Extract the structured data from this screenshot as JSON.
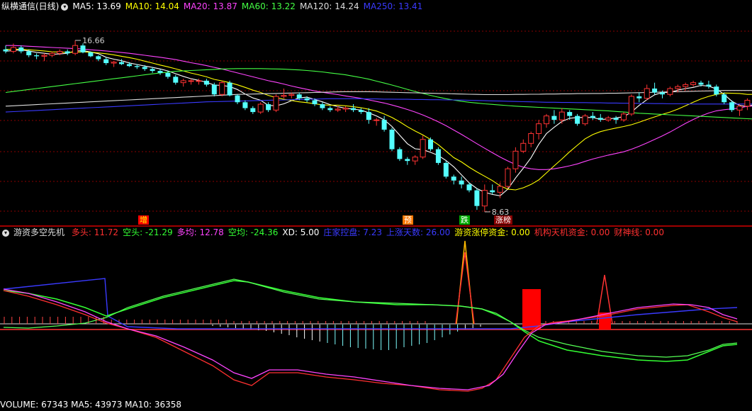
{
  "main_legend": {
    "title": "纵横通信(日线)",
    "items": [
      {
        "label": "MA5: 13.69",
        "color": "#ffffff"
      },
      {
        "label": "MA10: 14.04",
        "color": "#ffff00"
      },
      {
        "label": "MA20: 13.87",
        "color": "#ff44ff"
      },
      {
        "label": "MA60: 13.22",
        "color": "#44ff44"
      },
      {
        "label": "MA120: 14.24",
        "color": "#dddddd"
      },
      {
        "label": "MA250: 13.41",
        "color": "#3a3aff"
      }
    ]
  },
  "price_labels": {
    "high": "16.66",
    "low": "8.63"
  },
  "signals": [
    {
      "text": "增",
      "bg": "#ff0000",
      "color": "#ffff00"
    },
    {
      "text": "预",
      "bg": "#ff7700",
      "color": "#ffffff"
    },
    {
      "text": "跌",
      "bg": "#00aa00",
      "color": "#ffffff"
    },
    {
      "text": "涨榜",
      "bg": "#880000",
      "color": "#ffffff"
    }
  ],
  "sub_legend": {
    "title": "游资多空先机",
    "items": [
      {
        "label": "多头: 11.72",
        "color": "#ff3030"
      },
      {
        "label": "空头: -21.29",
        "color": "#33ff33"
      },
      {
        "label": "多均: 12.78",
        "color": "#ff44ff"
      },
      {
        "label": "空均: -24.36",
        "color": "#33ff33"
      },
      {
        "label": "XD: 5.00",
        "color": "#ffffff"
      },
      {
        "label": "庄家控盘: 7.23",
        "color": "#3a3aff"
      },
      {
        "label": "上涨天数: 26.00",
        "color": "#3a3aff"
      },
      {
        "label": "游资涨停资金: 0.00",
        "color": "#ffff00"
      },
      {
        "label": "机构天机资金: 0.00",
        "color": "#ff3030"
      },
      {
        "label": "财神线: 0.00",
        "color": "#ff3030"
      }
    ]
  },
  "volume_legend": "VOLUME: 67343  MA5: 43973  MA10: 36358",
  "colors": {
    "up": "#ff3333",
    "down": "#54ffff",
    "grid": "#8b0000",
    "divider": "#a00000"
  },
  "chart_data": {
    "type": "candlestick",
    "ylim": [
      7.5,
      18.0
    ],
    "candles": [
      [
        16.2,
        16.4,
        16.0,
        16.1
      ],
      [
        16.1,
        16.5,
        16.0,
        16.3
      ],
      [
        16.3,
        16.4,
        16.0,
        16.1
      ],
      [
        16.1,
        16.2,
        15.8,
        15.9
      ],
      [
        15.9,
        16.0,
        15.7,
        15.85
      ],
      [
        15.85,
        16.0,
        15.6,
        15.9
      ],
      [
        15.9,
        16.1,
        15.8,
        16.0
      ],
      [
        16.0,
        16.2,
        15.9,
        16.1
      ],
      [
        16.1,
        16.2,
        15.9,
        16.0
      ],
      [
        16.0,
        16.66,
        15.9,
        16.4
      ],
      [
        16.4,
        16.5,
        16.0,
        16.05
      ],
      [
        16.05,
        16.1,
        15.8,
        15.85
      ],
      [
        15.85,
        15.9,
        15.6,
        15.7
      ],
      [
        15.7,
        15.8,
        15.4,
        15.5
      ],
      [
        15.5,
        15.6,
        15.3,
        15.55
      ],
      [
        15.55,
        15.7,
        15.4,
        15.45
      ],
      [
        15.45,
        15.55,
        15.3,
        15.35
      ],
      [
        15.35,
        15.45,
        15.2,
        15.3
      ],
      [
        15.3,
        15.4,
        15.1,
        15.2
      ],
      [
        15.2,
        15.3,
        15.0,
        15.1
      ],
      [
        15.1,
        15.2,
        14.9,
        15.0
      ],
      [
        15.0,
        15.1,
        14.7,
        14.8
      ],
      [
        14.8,
        14.9,
        14.4,
        14.5
      ],
      [
        14.5,
        14.7,
        14.3,
        14.6
      ],
      [
        14.6,
        14.7,
        14.4,
        14.6
      ],
      [
        14.6,
        14.7,
        14.4,
        14.6
      ],
      [
        14.6,
        14.7,
        14.3,
        14.4
      ],
      [
        14.4,
        14.5,
        13.8,
        13.9
      ],
      [
        13.9,
        14.6,
        13.8,
        14.5
      ],
      [
        14.5,
        14.6,
        13.8,
        13.85
      ],
      [
        13.85,
        13.9,
        13.4,
        13.5
      ],
      [
        13.5,
        13.6,
        13.1,
        13.2
      ],
      [
        13.2,
        13.3,
        12.9,
        13.0
      ],
      [
        13.0,
        13.5,
        12.9,
        13.4
      ],
      [
        13.4,
        13.5,
        13.0,
        13.1
      ],
      [
        13.1,
        13.9,
        13.0,
        13.8
      ],
      [
        13.8,
        14.2,
        13.7,
        13.85
      ],
      [
        13.85,
        14.0,
        13.7,
        13.9
      ],
      [
        13.9,
        14.0,
        13.6,
        13.7
      ],
      [
        13.7,
        13.8,
        13.5,
        13.6
      ],
      [
        13.6,
        13.7,
        13.3,
        13.4
      ],
      [
        13.4,
        13.5,
        13.1,
        13.2
      ],
      [
        13.2,
        13.3,
        13.0,
        13.1
      ],
      [
        13.1,
        13.3,
        13.0,
        13.15
      ],
      [
        13.15,
        13.3,
        13.0,
        13.2
      ],
      [
        13.2,
        13.4,
        13.0,
        13.1
      ],
      [
        13.1,
        13.2,
        12.9,
        13.0
      ],
      [
        13.0,
        13.2,
        12.4,
        12.6
      ],
      [
        12.6,
        12.7,
        12.3,
        12.6
      ],
      [
        12.6,
        12.8,
        12.0,
        12.1
      ],
      [
        12.1,
        12.2,
        11.0,
        11.1
      ],
      [
        11.1,
        11.2,
        10.5,
        10.6
      ],
      [
        10.6,
        10.7,
        10.3,
        10.5
      ],
      [
        10.5,
        10.8,
        10.3,
        10.7
      ],
      [
        10.7,
        11.8,
        10.6,
        11.6
      ],
      [
        11.6,
        11.7,
        11.0,
        11.1
      ],
      [
        11.1,
        11.2,
        10.3,
        10.4
      ],
      [
        10.4,
        10.5,
        9.6,
        9.7
      ],
      [
        9.7,
        9.8,
        9.3,
        9.5
      ],
      [
        9.5,
        9.7,
        9.1,
        9.3
      ],
      [
        9.3,
        9.4,
        8.9,
        9.0
      ],
      [
        9.0,
        9.1,
        8.0,
        8.2
      ],
      [
        8.2,
        9.3,
        7.9,
        9.0
      ],
      [
        9.0,
        9.3,
        8.8,
        8.9
      ],
      [
        8.9,
        9.4,
        8.6,
        9.2
      ],
      [
        9.2,
        10.2,
        9.1,
        10.1
      ],
      [
        10.1,
        11.2,
        9.9,
        11.0
      ],
      [
        11.0,
        11.6,
        10.9,
        11.4
      ],
      [
        11.4,
        12.0,
        11.2,
        11.9
      ],
      [
        11.9,
        12.6,
        11.6,
        12.4
      ],
      [
        12.4,
        12.9,
        12.2,
        12.8
      ],
      [
        12.8,
        13.1,
        12.4,
        12.6
      ],
      [
        12.6,
        13.2,
        12.4,
        13.0
      ],
      [
        13.0,
        13.1,
        12.6,
        12.8
      ],
      [
        12.8,
        12.9,
        12.3,
        12.4
      ],
      [
        12.4,
        12.9,
        12.3,
        12.8
      ],
      [
        12.8,
        13.0,
        12.6,
        12.7
      ],
      [
        12.7,
        12.9,
        12.5,
        12.6
      ],
      [
        12.6,
        12.8,
        12.5,
        12.7
      ],
      [
        12.7,
        12.8,
        12.4,
        12.6
      ],
      [
        12.6,
        13.0,
        12.5,
        12.9
      ],
      [
        12.9,
        13.9,
        12.8,
        13.8
      ],
      [
        13.8,
        14.0,
        13.5,
        13.7
      ],
      [
        13.7,
        14.4,
        13.6,
        14.2
      ],
      [
        14.2,
        14.5,
        13.9,
        14.0
      ],
      [
        14.0,
        14.1,
        13.7,
        13.9
      ],
      [
        13.9,
        14.3,
        13.8,
        14.2
      ],
      [
        14.2,
        14.4,
        14.0,
        14.3
      ],
      [
        14.3,
        14.5,
        14.1,
        14.4
      ],
      [
        14.4,
        14.6,
        14.3,
        14.5
      ],
      [
        14.5,
        14.6,
        14.3,
        14.4
      ],
      [
        14.4,
        14.6,
        14.2,
        14.3
      ],
      [
        14.3,
        14.4,
        13.8,
        13.9
      ],
      [
        13.9,
        14.0,
        13.4,
        13.5
      ],
      [
        13.5,
        13.6,
        13.0,
        13.1
      ],
      [
        13.1,
        13.4,
        12.8,
        13.3
      ],
      [
        13.3,
        13.7,
        13.1,
        13.6
      ],
      [
        13.6,
        14.2,
        13.5,
        14.1
      ]
    ],
    "ma": [
      {
        "name": "MA5",
        "color": "#ffffff",
        "values": [
          16.1,
          16.15,
          16.18,
          16.12,
          16.05,
          16.0,
          15.95,
          15.97,
          16.0,
          16.12,
          16.14,
          16.07,
          15.98,
          15.8,
          15.7,
          15.62,
          15.51,
          15.43,
          15.35,
          15.28,
          15.2,
          15.1,
          14.96,
          14.82,
          14.7,
          14.62,
          14.52,
          14.38,
          14.36,
          14.3,
          14.15,
          13.92,
          13.72,
          13.6,
          13.34,
          13.32,
          13.42,
          13.58,
          13.72,
          13.76,
          13.64,
          13.52,
          13.38,
          13.27,
          13.19,
          13.15,
          13.1,
          12.96,
          12.8,
          12.6,
          12.26,
          11.82,
          11.38,
          11.12,
          11.08,
          10.94,
          10.78,
          10.52,
          10.2,
          9.79,
          9.38,
          9.09,
          8.9,
          8.79,
          8.72,
          9.06,
          9.63,
          10.13,
          10.66,
          11.35,
          11.9,
          12.22,
          12.52,
          12.68,
          12.72,
          12.72,
          12.72,
          12.62,
          12.64,
          12.7,
          12.76,
          13.0,
          13.34,
          13.63,
          13.88,
          14.0,
          14.0,
          14.12,
          14.2,
          14.26,
          14.36,
          14.32,
          14.18,
          13.9,
          13.55,
          13.34,
          13.28,
          13.4
        ]
      },
      {
        "name": "MA10",
        "color": "#ffff00",
        "values": [
          16.2,
          16.2,
          16.2,
          16.18,
          16.15,
          16.12,
          16.08,
          16.06,
          16.05,
          16.06,
          16.07,
          16.06,
          16.02,
          15.98,
          15.92,
          15.85,
          15.78,
          15.7,
          15.6,
          15.5,
          15.4,
          15.31,
          15.21,
          15.1,
          14.99,
          14.9,
          14.8,
          14.67,
          14.59,
          14.5,
          14.39,
          14.26,
          14.12,
          14.0,
          13.85,
          13.74,
          13.65,
          13.59,
          13.52,
          13.48,
          13.42,
          13.37,
          13.35,
          13.35,
          13.32,
          13.27,
          13.22,
          13.14,
          13.05,
          12.9,
          12.72,
          12.5,
          12.25,
          12.03,
          11.83,
          11.6,
          11.33,
          11.0,
          10.67,
          10.45,
          10.18,
          9.94,
          9.72,
          9.5,
          9.23,
          9.06,
          9.02,
          9.13,
          9.3,
          9.53,
          9.89,
          10.25,
          10.6,
          10.97,
          11.3,
          11.63,
          11.85,
          12.0,
          12.1,
          12.18,
          12.26,
          12.35,
          12.48,
          12.62,
          12.75,
          12.88,
          13.0,
          13.15,
          13.32,
          13.5,
          13.67,
          13.8,
          13.9,
          13.97,
          13.96,
          13.95,
          13.9,
          13.9
        ]
      },
      {
        "name": "MA20",
        "color": "#ff44ff",
        "values": [
          16.4,
          16.4,
          16.38,
          16.36,
          16.34,
          16.32,
          16.3,
          16.28,
          16.26,
          16.24,
          16.22,
          16.18,
          16.15,
          16.12,
          16.08,
          16.04,
          16.0,
          15.95,
          15.9,
          15.85,
          15.8,
          15.74,
          15.68,
          15.6,
          15.52,
          15.45,
          15.37,
          15.28,
          15.2,
          15.1,
          15.0,
          14.9,
          14.8,
          14.7,
          14.6,
          14.52,
          14.43,
          14.33,
          14.24,
          14.16,
          14.08,
          14.01,
          13.95,
          13.89,
          13.82,
          13.76,
          13.7,
          13.62,
          13.54,
          13.46,
          13.36,
          13.25,
          13.13,
          13.0,
          12.85,
          12.68,
          12.5,
          12.3,
          12.08,
          11.86,
          11.62,
          11.38,
          11.15,
          10.92,
          10.7,
          10.5,
          10.32,
          10.18,
          10.1,
          10.06,
          10.06,
          10.1,
          10.17,
          10.25,
          10.35,
          10.48,
          10.6,
          10.7,
          10.8,
          10.88,
          10.97,
          11.1,
          11.25,
          11.42,
          11.6,
          11.78,
          11.98,
          12.2,
          12.42,
          12.62,
          12.8,
          12.95,
          13.06,
          13.12,
          13.16,
          13.2,
          13.3,
          13.3
        ]
      },
      {
        "name": "MA60",
        "color": "#44ff44",
        "values": [
          14.0,
          14.05,
          14.1,
          14.15,
          14.2,
          14.25,
          14.3,
          14.35,
          14.4,
          14.45,
          14.5,
          14.55,
          14.6,
          14.65,
          14.7,
          14.75,
          14.8,
          14.85,
          14.9,
          14.95,
          15.0,
          15.04,
          15.08,
          15.1,
          15.12,
          15.14,
          15.16,
          15.18,
          15.2,
          15.21,
          15.22,
          15.22,
          15.22,
          15.22,
          15.21,
          15.2,
          15.19,
          15.17,
          15.15,
          15.12,
          15.09,
          15.05,
          15.0,
          14.95,
          14.9,
          14.83,
          14.76,
          14.68,
          14.58,
          14.48,
          14.38,
          14.27,
          14.16,
          14.05,
          13.95,
          13.85,
          13.76,
          13.68,
          13.61,
          13.55,
          13.5,
          13.46,
          13.42,
          13.39,
          13.36,
          13.33,
          13.3,
          13.28,
          13.26,
          13.24,
          13.22,
          13.2,
          13.18,
          13.16,
          13.14,
          13.12,
          13.1,
          13.08,
          13.06,
          13.03,
          13.0,
          12.97,
          12.94,
          12.92,
          12.9,
          12.88,
          12.86,
          12.84,
          12.82,
          12.8,
          12.78,
          12.76,
          12.74,
          12.72,
          12.7,
          12.68,
          12.66,
          12.64
        ]
      },
      {
        "name": "MA120",
        "color": "#dddddd",
        "values": [
          13.3,
          13.32,
          13.34,
          13.36,
          13.38,
          13.4,
          13.42,
          13.44,
          13.46,
          13.48,
          13.5,
          13.52,
          13.54,
          13.56,
          13.58,
          13.6,
          13.62,
          13.64,
          13.66,
          13.68,
          13.7,
          13.72,
          13.74,
          13.76,
          13.78,
          13.8,
          13.82,
          13.84,
          13.86,
          13.88,
          13.9,
          13.91,
          13.92,
          13.93,
          13.94,
          13.95,
          13.96,
          13.97,
          13.98,
          13.99,
          14.0,
          14.01,
          14.02,
          14.03,
          14.04,
          14.04,
          14.04,
          14.04,
          14.03,
          14.02,
          14.01,
          14.0,
          13.99,
          13.98,
          13.97,
          13.96,
          13.95,
          13.94,
          13.93,
          13.92,
          13.91,
          13.9,
          13.89,
          13.89,
          13.89,
          13.89,
          13.9,
          13.9,
          13.91,
          13.91,
          13.92,
          13.92,
          13.93,
          13.93,
          13.94,
          13.94,
          13.95,
          13.95,
          13.96,
          13.96,
          13.97,
          13.98,
          13.99,
          14.0,
          14.01,
          14.02,
          14.03,
          14.04,
          14.05,
          14.06,
          14.07,
          14.08,
          14.09,
          14.1,
          14.1,
          14.1,
          14.1,
          14.1
        ]
      },
      {
        "name": "MA250",
        "color": "#3a3aff",
        "values": [
          13.0,
          13.02,
          13.04,
          13.06,
          13.08,
          13.1,
          13.12,
          13.14,
          13.16,
          13.18,
          13.2,
          13.22,
          13.24,
          13.26,
          13.28,
          13.3,
          13.32,
          13.34,
          13.36,
          13.38,
          13.4,
          13.42,
          13.44,
          13.46,
          13.48,
          13.5,
          13.52,
          13.53,
          13.54,
          13.55,
          13.56,
          13.57,
          13.58,
          13.59,
          13.6,
          13.61,
          13.62,
          13.63,
          13.64,
          13.65,
          13.66,
          13.67,
          13.68,
          13.68,
          13.68,
          13.68,
          13.68,
          13.67,
          13.67,
          13.66,
          13.66,
          13.65,
          13.65,
          13.64,
          13.64,
          13.63,
          13.63,
          13.62,
          13.62,
          13.61,
          13.6,
          13.59,
          13.58,
          13.57,
          13.56,
          13.55,
          13.54,
          13.53,
          13.52,
          13.51,
          13.5,
          13.5,
          13.49,
          13.49,
          13.48,
          13.48,
          13.47,
          13.47,
          13.46,
          13.46,
          13.45,
          13.45,
          13.44,
          13.44,
          13.43,
          13.43,
          13.42,
          13.42,
          13.42,
          13.41,
          13.41,
          13.41,
          13.41,
          13.41,
          13.41,
          13.41,
          13.41,
          13.41
        ]
      }
    ]
  }
}
